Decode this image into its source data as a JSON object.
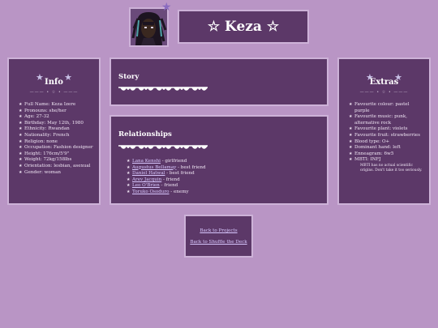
{
  "header": {
    "title": "☆ Keza ☆"
  },
  "info": {
    "title": "Info",
    "divider": "——— • ☆ • ———",
    "items": [
      "Full Name: Keza Izere",
      "Pronouns: she/her",
      "Age: 27-32",
      "Birthday: May 12th, 1980",
      "Ethnicity: Rwandan",
      "Nationality: French",
      "Religion: none",
      "Occupation: Fashion designer",
      "Height: 176cm/5'9\"",
      "Weight: 72kg/158lbs",
      "Orientation: lesbian, asexual",
      "Gender: woman"
    ]
  },
  "story": {
    "title": "Story"
  },
  "relationships": {
    "title": "Relationships",
    "items": [
      {
        "name": "Lana Kenshi",
        "role": " - girlfriend"
      },
      {
        "name": "Augustus Bellamay",
        "role": " - best friend"
      },
      {
        "name": "Daniel Hatwal",
        "role": " - best friend"
      },
      {
        "name": "Arev Jacquin",
        "role": " - friend"
      },
      {
        "name": "Leo O'Brien",
        "role": " - friend"
      },
      {
        "name": "Toruko Osoduro",
        "role": " - enemy"
      }
    ]
  },
  "extras": {
    "title": "Extras",
    "divider": "——— • ☆ • ———",
    "items": [
      "Favourite colour: pastel purple",
      "Favourite music: punk, alternative rock",
      "Favourite plant: violets",
      "Favourite fruit: strawberries",
      "Blood type: O+",
      "Dominant hand: left",
      "Enneagram: 6w5",
      "MBTI: INFJ"
    ],
    "note": "MBTI has no actual scientific origins. Don't take it too seriously."
  },
  "nav": {
    "back_projects": "Back to Projects",
    "back_shuffle": "Back to Shuffle the Deck"
  },
  "colors": {
    "background": "#b995c5",
    "panel": "#5c3868",
    "border": "#cdb2d8",
    "link": "#d9c8ff"
  }
}
